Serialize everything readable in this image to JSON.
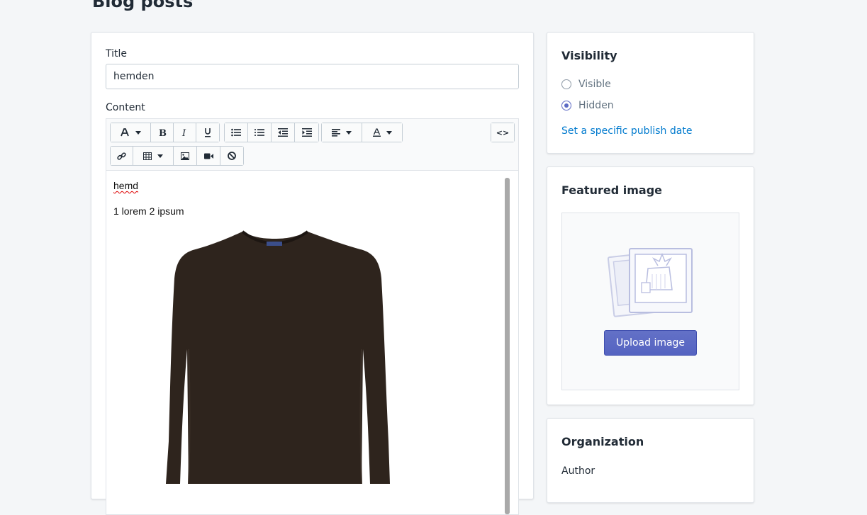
{
  "page": {
    "title": "Blog posts"
  },
  "form": {
    "title_label": "Title",
    "title_value": "hemden",
    "content_label": "Content"
  },
  "toolbar": {
    "row1": [
      "font-icon",
      "bold-icon",
      "italic-icon",
      "underline-icon",
      "bullet-list-icon",
      "numbered-list-icon",
      "outdent-icon",
      "indent-icon",
      "align-icon",
      "text-color-icon",
      "code-view-icon"
    ],
    "row2": [
      "link-icon",
      "table-icon",
      "image-icon",
      "video-icon",
      "clear-format-icon"
    ],
    "code_label": "<>"
  },
  "editor": {
    "paragraphs": [
      "hemd",
      "1 lorem 2 ipsum"
    ],
    "image": {
      "alt": "dark brown long sleeve sweater"
    }
  },
  "visibility": {
    "title": "Visibility",
    "options": [
      {
        "label": "Visible",
        "checked": false
      },
      {
        "label": "Hidden",
        "checked": true
      }
    ],
    "publish_link": "Set a specific publish date"
  },
  "featured_image": {
    "title": "Featured image",
    "upload_label": "Upload image"
  },
  "organization": {
    "title": "Organization",
    "author_label": "Author"
  },
  "colors": {
    "accent": "#5c6ac4",
    "link": "#007ace",
    "background": "#f4f6f8"
  }
}
